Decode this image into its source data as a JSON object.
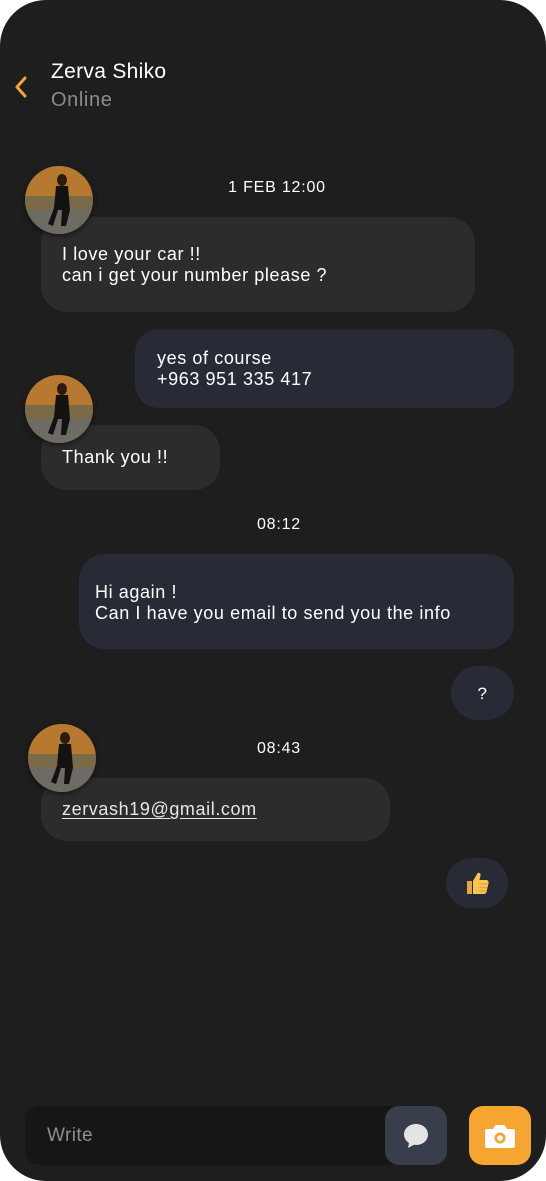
{
  "header": {
    "contact_name": "Zerva Shiko",
    "status": "Online",
    "accent_color": "#F7A531"
  },
  "messages": {
    "stamp_1": "1 FEB 12:00",
    "msg_1_line_1": "I love your car !!",
    "msg_1_line_2": "can i get your number please ?",
    "msg_2_line_1": "yes of course",
    "msg_2_line_2": "+963 951 335 417",
    "msg_3": "Thank you !!",
    "stamp_2": "08:12",
    "msg_4_line_1": "Hi again !",
    "msg_4_line_2": "Can I have you email to send you the info",
    "msg_5": "?",
    "stamp_3": "08:43",
    "msg_6_email": "zervash19@gmail.com",
    "msg_7_emoji": "👍"
  },
  "composer": {
    "placeholder": "Write",
    "chat_icon": "chat-bubble-icon",
    "camera_icon": "camera-icon"
  },
  "colors": {
    "background": "#1E1E1E",
    "incoming_bubble": "#2C2C2C",
    "outgoing_bubble": "#282A36",
    "camera_button": "#F7A531",
    "chat_button": "#393E4C"
  }
}
